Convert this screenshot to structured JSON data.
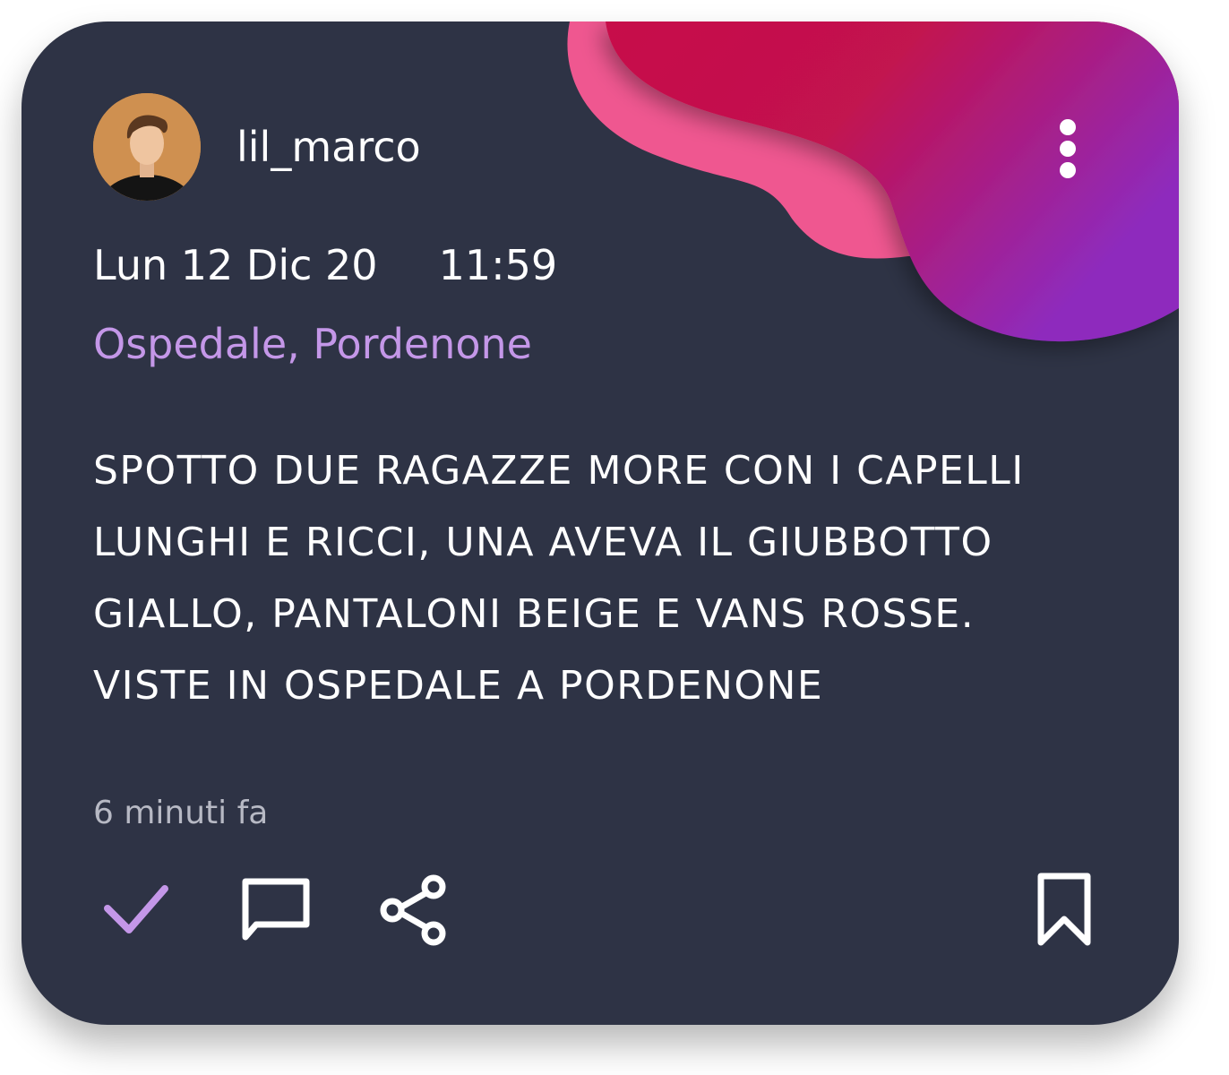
{
  "post": {
    "username": "lil_marco",
    "date": "Lun 12 Dic 20",
    "time": "11:59",
    "location": "Ospedale, Pordenone",
    "text_lines": [
      "SPOTTO DUE RAGAZZE MORE CON I CAPELLI",
      "LUNGHI E RICCI, UNA AVEVA IL GIUBBOTTO",
      "GIALLO, PANTALONI BEIGE E VANS ROSSE.",
      "VISTE IN OSPEDALE A PORDENONE"
    ],
    "relative_time": "6 minuti fa"
  },
  "actions": [
    {
      "name": "check-icon",
      "state": "active"
    },
    {
      "name": "comment-icon"
    },
    {
      "name": "share-icon"
    },
    {
      "name": "bookmark-icon"
    }
  ],
  "colors": {
    "card_background": "#2e3345",
    "accent": "#c497e8",
    "blob_pink": "#ef5790",
    "blob_magenta": "#c2124f",
    "blob_purple": "#8e2bbd"
  }
}
